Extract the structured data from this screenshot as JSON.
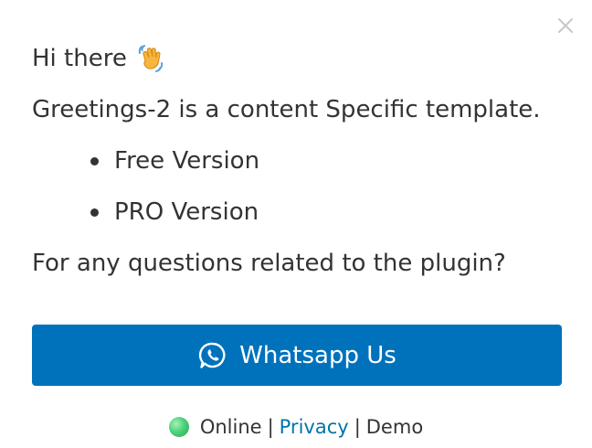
{
  "greeting": {
    "text": "Hi there",
    "emoji_icon": "waving-hand-icon"
  },
  "intro": "Greetings-2 is a content Specific template.",
  "features": [
    "Free Version",
    "PRO Version"
  ],
  "question": "For any questions related to the plugin?",
  "cta": {
    "label": "Whatsapp Us",
    "icon": "whatsapp-icon",
    "color": "#0072bc"
  },
  "footer": {
    "status": "Online",
    "separator": "|",
    "privacy_link": "Privacy",
    "demo": "Demo",
    "status_color": "#4cd27a",
    "link_color": "#0073aa"
  },
  "close": {
    "icon": "close-icon"
  }
}
